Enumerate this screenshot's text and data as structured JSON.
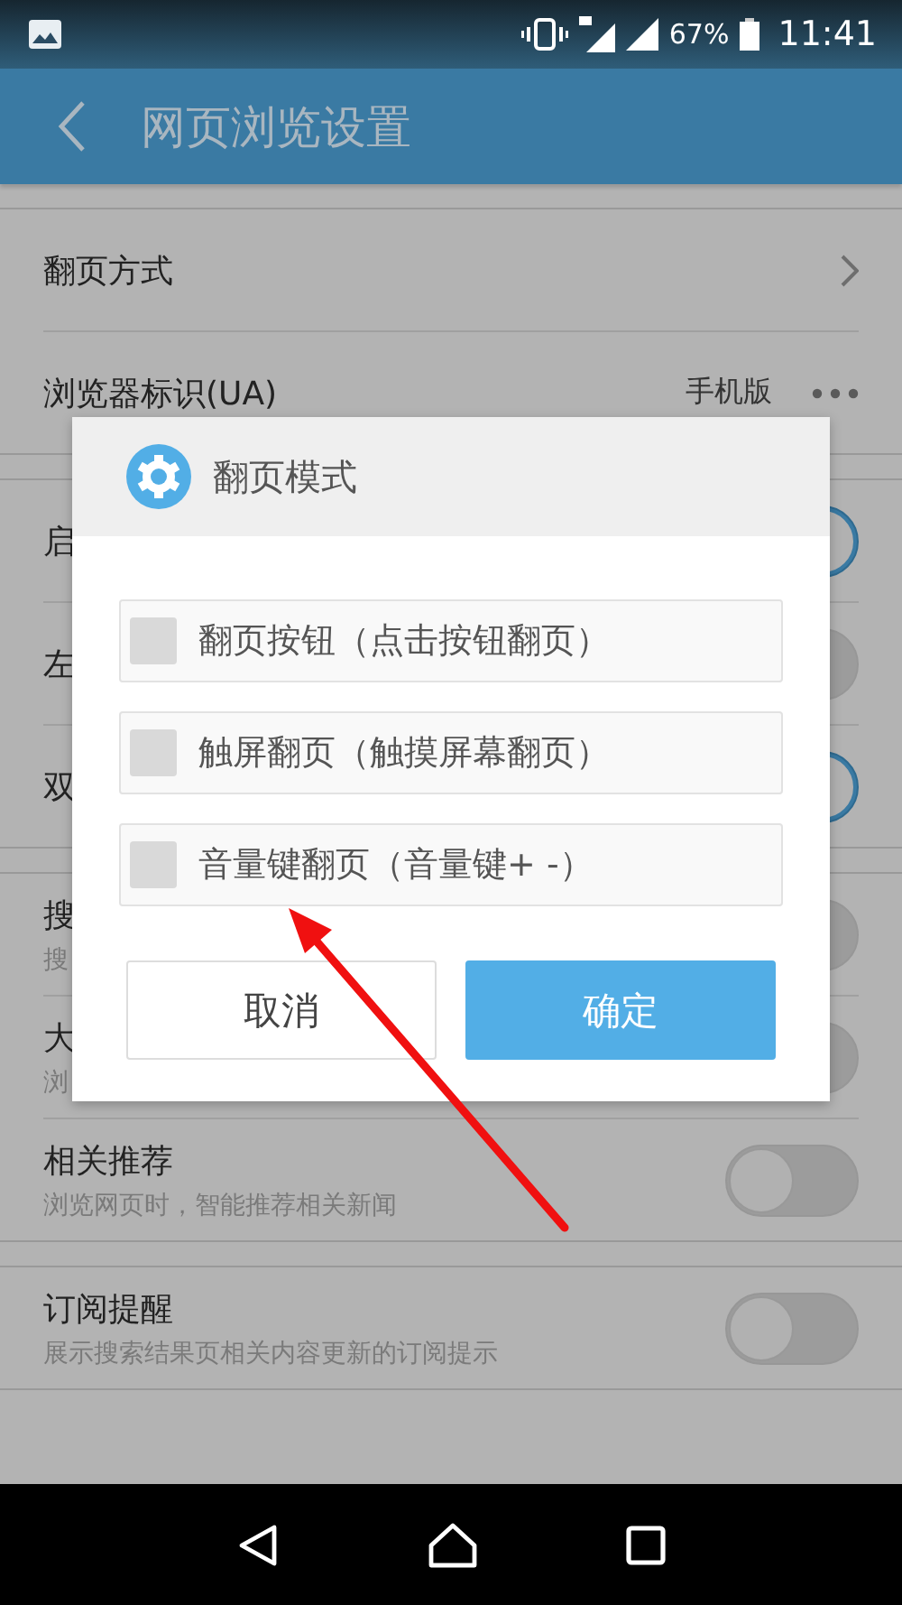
{
  "status_bar": {
    "battery": "67%",
    "time": "11:41"
  },
  "app_bar": {
    "title": "网页浏览设置"
  },
  "sections": [
    {
      "rows": [
        {
          "kind": "link",
          "title": "翻页方式"
        },
        {
          "kind": "value",
          "title": "浏览器标识(UA)",
          "value": "手机版"
        }
      ]
    },
    {
      "rows": [
        {
          "kind": "toggle",
          "title": "启",
          "on": true
        },
        {
          "kind": "toggle",
          "title": "左",
          "on": false
        },
        {
          "kind": "toggle",
          "title": "双",
          "on": true
        }
      ]
    },
    {
      "rows": [
        {
          "kind": "toggle",
          "title": "搜",
          "subtitle": "搜",
          "on": false
        },
        {
          "kind": "toggle",
          "title": "大",
          "subtitle": "浏",
          "on": false
        },
        {
          "kind": "toggle",
          "title": "相关推荐",
          "subtitle": "浏览网页时，智能推荐相关新闻",
          "on": false
        }
      ]
    },
    {
      "rows": [
        {
          "kind": "toggle",
          "title": "订阅提醒",
          "subtitle": "展示搜索结果页相关内容更新的订阅提示",
          "on": false
        }
      ]
    }
  ],
  "dialog": {
    "title": "翻页模式",
    "options": [
      {
        "label": "翻页按钮（点击按钮翻页）",
        "checked": false
      },
      {
        "label": "触屏翻页（触摸屏幕翻页）",
        "checked": false
      },
      {
        "label": "音量键翻页（音量键+ -）",
        "checked": false
      }
    ],
    "buttons": [
      {
        "label": "取消",
        "kind": "secondary"
      },
      {
        "label": "确定",
        "kind": "primary"
      }
    ]
  }
}
